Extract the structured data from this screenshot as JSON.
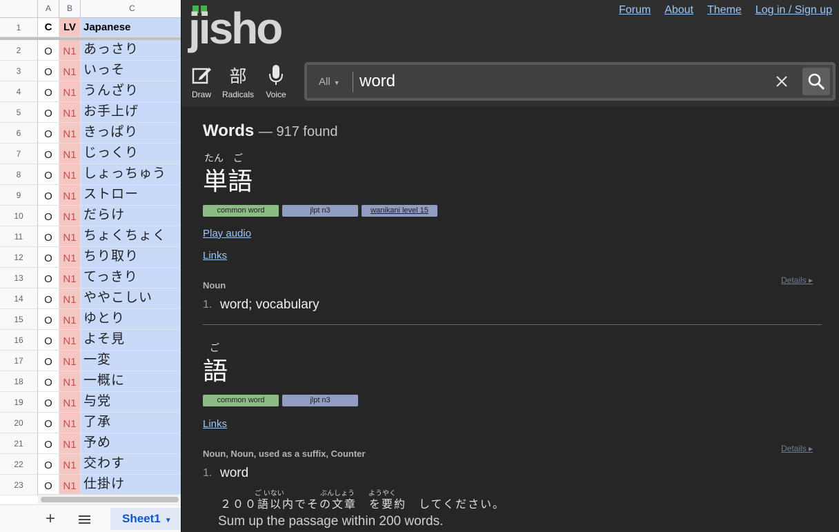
{
  "sheet": {
    "columns": [
      "A",
      "B",
      "C"
    ],
    "header_row": {
      "num": "1",
      "a": "C",
      "b": "LV",
      "c": "Japanese"
    },
    "rows": [
      {
        "num": "2",
        "a": "O",
        "b": "N1",
        "c": "あっさり"
      },
      {
        "num": "3",
        "a": "O",
        "b": "N1",
        "c": "いっそ"
      },
      {
        "num": "4",
        "a": "O",
        "b": "N1",
        "c": "うんざり"
      },
      {
        "num": "5",
        "a": "O",
        "b": "N1",
        "c": "お手上げ"
      },
      {
        "num": "6",
        "a": "O",
        "b": "N1",
        "c": "きっぱり"
      },
      {
        "num": "7",
        "a": "O",
        "b": "N1",
        "c": "じっくり"
      },
      {
        "num": "8",
        "a": "O",
        "b": "N1",
        "c": "しょっちゅう"
      },
      {
        "num": "9",
        "a": "O",
        "b": "N1",
        "c": "ストロー"
      },
      {
        "num": "10",
        "a": "O",
        "b": "N1",
        "c": "だらけ"
      },
      {
        "num": "11",
        "a": "O",
        "b": "N1",
        "c": "ちょくちょく"
      },
      {
        "num": "12",
        "a": "O",
        "b": "N1",
        "c": "ちり取り"
      },
      {
        "num": "13",
        "a": "O",
        "b": "N1",
        "c": "てっきり"
      },
      {
        "num": "14",
        "a": "O",
        "b": "N1",
        "c": "ややこしい"
      },
      {
        "num": "15",
        "a": "O",
        "b": "N1",
        "c": "ゆとり"
      },
      {
        "num": "16",
        "a": "O",
        "b": "N1",
        "c": "よそ見"
      },
      {
        "num": "17",
        "a": "O",
        "b": "N1",
        "c": "一変"
      },
      {
        "num": "18",
        "a": "O",
        "b": "N1",
        "c": "一概に"
      },
      {
        "num": "19",
        "a": "O",
        "b": "N1",
        "c": "与党"
      },
      {
        "num": "20",
        "a": "O",
        "b": "N1",
        "c": "了承"
      },
      {
        "num": "21",
        "a": "O",
        "b": "N1",
        "c": "予め"
      },
      {
        "num": "22",
        "a": "O",
        "b": "N1",
        "c": "交わす"
      },
      {
        "num": "23",
        "a": "O",
        "b": "N1",
        "c": "仕掛け"
      }
    ],
    "tab": {
      "add_icon": "plus-icon",
      "menu_icon": "hamburger-icon",
      "sheet_name": "Sheet1"
    }
  },
  "jisho": {
    "logo": "jisho",
    "nav": {
      "forum": "Forum",
      "about": "About",
      "theme": "Theme",
      "login": "Log in / Sign up"
    },
    "tools": {
      "draw": "Draw",
      "radicals_glyph": "部",
      "radicals": "Radicals",
      "voice": "Voice"
    },
    "search": {
      "filter": "All",
      "query": "word"
    },
    "colors": {
      "background": "#262626",
      "link": "#9cc6f5",
      "common_tag": "#8abc83",
      "jlpt_tag": "#909dc0",
      "logo_green": "#3fb649"
    },
    "results": {
      "heading": "Words",
      "count_text": "— 917 found",
      "entry1": {
        "furigana_1": "たん",
        "furigana_2": "ご",
        "word": "単語",
        "tag_common": "common word",
        "tag_jlpt": "jlpt n3",
        "tag_wanikani": "wanikani level 15",
        "play_audio": "Play audio",
        "links": "Links",
        "pos": "Noun",
        "details": "Details ▸",
        "sense_num": "1.",
        "sense": "word; vocabulary"
      },
      "entry2": {
        "furigana": "ご",
        "word": "語",
        "tag_common": "common word",
        "tag_jlpt": "jlpt n3",
        "links": "Links",
        "pos": "Noun, Noun, used as a suffix, Counter",
        "details": "Details ▸",
        "sense_num": "1.",
        "sense": "word",
        "example_furigana_1": "ご いない",
        "example_furigana_2": "ぶんしょう",
        "example_furigana_3": "ようやく",
        "example_jp": "２００語以内でその文章　を要約　してください。",
        "example_en": "Sum up the passage within 200 words."
      }
    }
  }
}
